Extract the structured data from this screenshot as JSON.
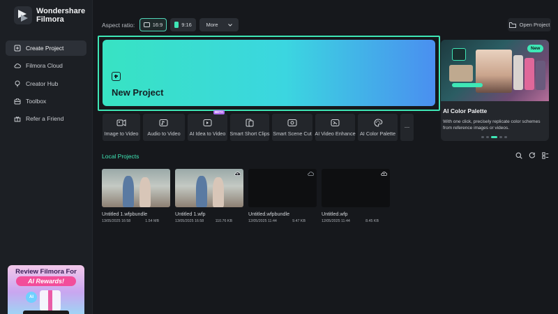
{
  "app": {
    "brand_line1": "Wondershare",
    "brand_line2": "Filmora"
  },
  "sidebar": {
    "items": [
      {
        "label": "Create Project",
        "icon": "create-project-icon",
        "active": true
      },
      {
        "label": "Filmora Cloud",
        "icon": "cloud-icon",
        "active": false
      },
      {
        "label": "Creator Hub",
        "icon": "bulb-icon",
        "active": false
      },
      {
        "label": "Toolbox",
        "icon": "toolbox-icon",
        "active": false
      },
      {
        "label": "Refer a Friend",
        "icon": "gift-icon",
        "active": false
      }
    ],
    "promo": {
      "title": "Review Filmora For",
      "badge": "AI Rewards!",
      "ai_label": "AI"
    }
  },
  "header": {
    "aspect_label": "Aspect ratio:",
    "ratio_169": "16:9",
    "ratio_916": "9:16",
    "more": "More",
    "open_project": "Open Project"
  },
  "new_project": {
    "label": "New Project"
  },
  "tools": [
    {
      "label": "Image to Video",
      "icon": "image-to-video-icon"
    },
    {
      "label": "Audio to Video",
      "icon": "audio-to-video-icon"
    },
    {
      "label": "AI Idea to Video",
      "icon": "ai-idea-icon",
      "badge": "BETA"
    },
    {
      "label": "Smart Short Clips",
      "icon": "short-clips-icon"
    },
    {
      "label": "Smart Scene Cut",
      "icon": "scene-cut-icon"
    },
    {
      "label": "AI Video Enhance",
      "icon": "video-enhance-icon"
    },
    {
      "label": "AI Color Palette",
      "icon": "color-palette-icon"
    }
  ],
  "more_tools": "...",
  "feature_card": {
    "badge": "New",
    "title": "AI Color Palette",
    "description": "With one click, precisely replicate color schemes from reference images or videos."
  },
  "local_projects": {
    "title": "Local Projects",
    "items": [
      {
        "name": "Untitled 1.wfpbundle",
        "date": "13/05/2025 16:58",
        "size": "1.54 MB"
      },
      {
        "name": "Untitled 1.wfp",
        "date": "13/05/2025 16:58",
        "size": "110.76 KB"
      },
      {
        "name": "Untitled.wfpbundle",
        "date": "12/05/2025 11:44",
        "size": "9.47 KB"
      },
      {
        "name": "Untitled.wfp",
        "date": "12/05/2025 11:44",
        "size": "8.45 KB"
      }
    ]
  },
  "colors": {
    "accent": "#3fe7b6",
    "background": "#16181c",
    "sidebar": "#1c1f24"
  }
}
